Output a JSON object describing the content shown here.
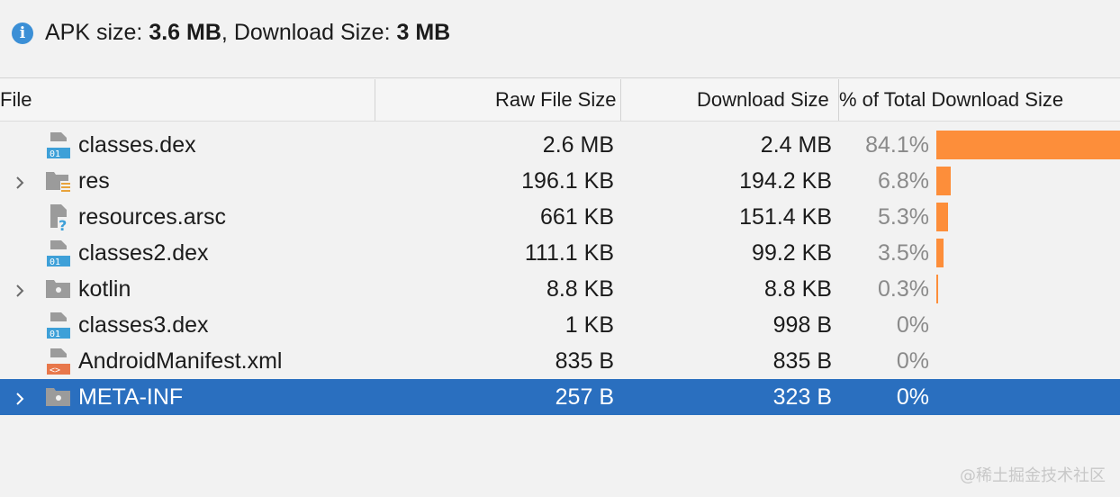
{
  "summary": {
    "apk_label": "APK size: ",
    "apk_value": "3.6 MB",
    "sep": ", Download Size: ",
    "download_value": "3 MB"
  },
  "columns": {
    "file": "File",
    "raw": "Raw File Size",
    "download": "Download Size",
    "percent": "% of Total Download Size"
  },
  "rows": [
    {
      "name": "classes.dex",
      "raw": "2.6 MB",
      "download": "2.4 MB",
      "percent": "84.1%",
      "share": 0.841,
      "icon": "dex-file-icon",
      "expandable": false
    },
    {
      "name": "res",
      "raw": "196.1 KB",
      "download": "194.2 KB",
      "percent": "6.8%",
      "share": 0.068,
      "icon": "resource-folder-icon",
      "expandable": true
    },
    {
      "name": "resources.arsc",
      "raw": "661 KB",
      "download": "151.4 KB",
      "percent": "5.3%",
      "share": 0.053,
      "icon": "unknown-file-icon",
      "expandable": false
    },
    {
      "name": "classes2.dex",
      "raw": "111.1 KB",
      "download": "99.2 KB",
      "percent": "3.5%",
      "share": 0.035,
      "icon": "dex-file-icon",
      "expandable": false
    },
    {
      "name": "kotlin",
      "raw": "8.8 KB",
      "download": "8.8 KB",
      "percent": "0.3%",
      "share": 0.003,
      "icon": "folder-icon",
      "expandable": true
    },
    {
      "name": "classes3.dex",
      "raw": "1 KB",
      "download": "998 B",
      "percent": "0%",
      "share": 0,
      "icon": "dex-file-icon",
      "expandable": false
    },
    {
      "name": "AndroidManifest.xml",
      "raw": "835 B",
      "download": "835 B",
      "percent": "0%",
      "share": 0,
      "icon": "xml-file-icon",
      "expandable": false
    },
    {
      "name": "META-INF",
      "raw": "257 B",
      "download": "323 B",
      "percent": "0%",
      "share": 0,
      "icon": "folder-icon",
      "expandable": true,
      "selected": true
    }
  ],
  "colors": {
    "bar": "#fd8e3a",
    "selection": "#2a6fbf"
  },
  "watermark": "@稀土掘金技术社区"
}
